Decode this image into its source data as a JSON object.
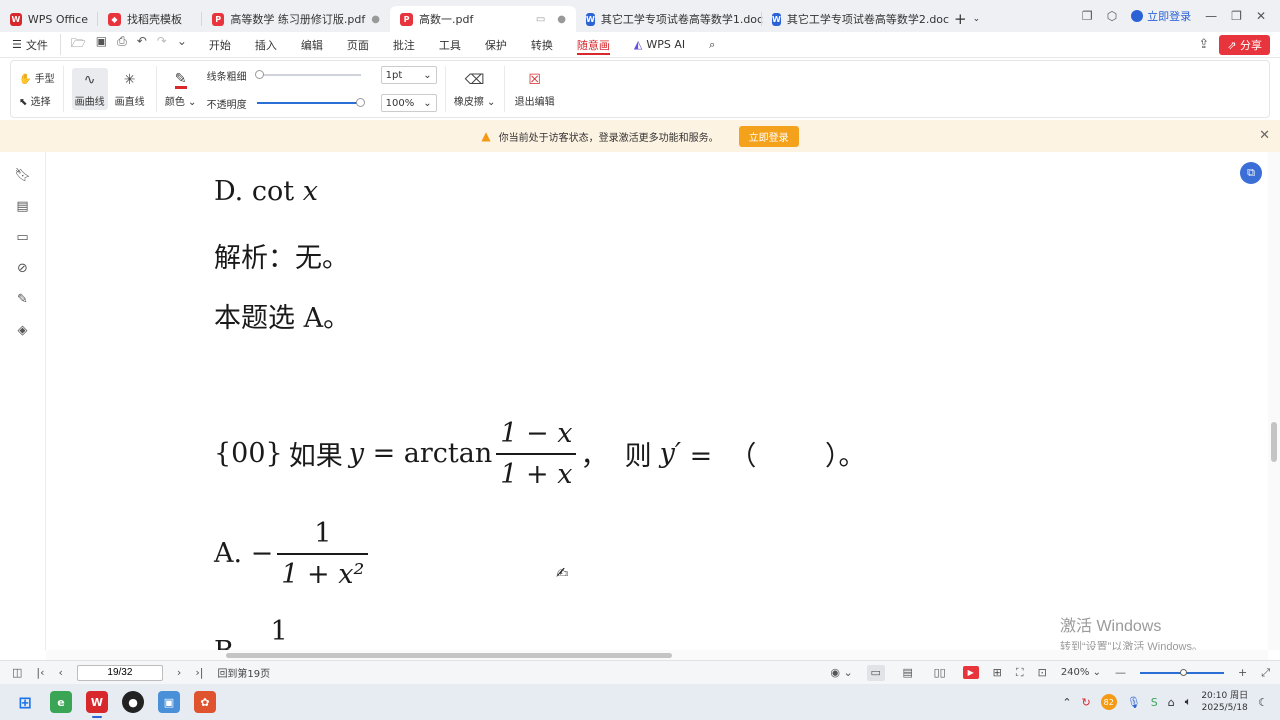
{
  "tabs": [
    {
      "label": "WPS Office",
      "icon": "wps-logo-icon",
      "color": "#d8282c",
      "active": false
    },
    {
      "label": "找稻壳模板",
      "icon": "docer-icon",
      "color": "#e8343c",
      "active": false
    },
    {
      "label": "高等数学 练习册修订版.pdf",
      "icon": "pdf-icon",
      "color": "#e8343c",
      "active": false
    },
    {
      "label": "高数一.pdf",
      "icon": "pdf-icon",
      "color": "#e8343c",
      "active": true
    },
    {
      "label": "其它工学专项试卷高等数学1.doc",
      "icon": "word-icon",
      "color": "#2b62d6",
      "active": false
    },
    {
      "label": "其它工学专项试卷高等数学2.doc",
      "icon": "word-icon",
      "color": "#2b62d6",
      "active": false
    }
  ],
  "header": {
    "login_label": "立即登录"
  },
  "menubar": {
    "file_label": "文件",
    "items": [
      "开始",
      "插入",
      "编辑",
      "页面",
      "批注",
      "工具",
      "保护",
      "转换",
      "随意画"
    ],
    "active_item": "随意画",
    "ai_label": "WPS AI",
    "share_label": "分享"
  },
  "ribbon": {
    "hand_label": "手型",
    "select_label": "选择",
    "curve_label": "画曲线",
    "line_label": "画直线",
    "color_label": "颜色",
    "thickness_label": "线条粗细",
    "opacity_label": "不透明度",
    "thickness_value": "1pt",
    "opacity_value": "100%",
    "eraser_label": "橡皮擦",
    "exit_label": "退出编辑",
    "pen_color": "#d8282c"
  },
  "notice": {
    "text": "你当前处于访客状态，登录激活更多功能和服务。",
    "button_label": "立即登录"
  },
  "document": {
    "line1_prefix": "D. ",
    "line1_fn": "cot",
    "line1_var": "x",
    "line2": "解析：无。",
    "line3": "本题选 A。",
    "q_label": "{00}",
    "q_text1": "如果",
    "q_y": "y",
    "q_eq": " = arctan",
    "q_num": "1 − x",
    "q_den": "1 + x",
    "q_text2": "，  则",
    "q_yp": "y′",
    "q_text3": " =  （        ）。",
    "optA_prefix": "A. −",
    "optA_num": "1",
    "optA_den": "1 + x²",
    "optB_prefix": "B.",
    "optB_num": "1"
  },
  "watermark": {
    "line1": "激活 Windows",
    "line2": "转到“设置”以激活 Windows。"
  },
  "statusbar": {
    "page_value": "19/32",
    "back_label": "回到第19页",
    "zoom_value": "240%"
  },
  "taskbar": {
    "time": "20:10 周日",
    "date": "2025/5/18",
    "badge": "82"
  }
}
